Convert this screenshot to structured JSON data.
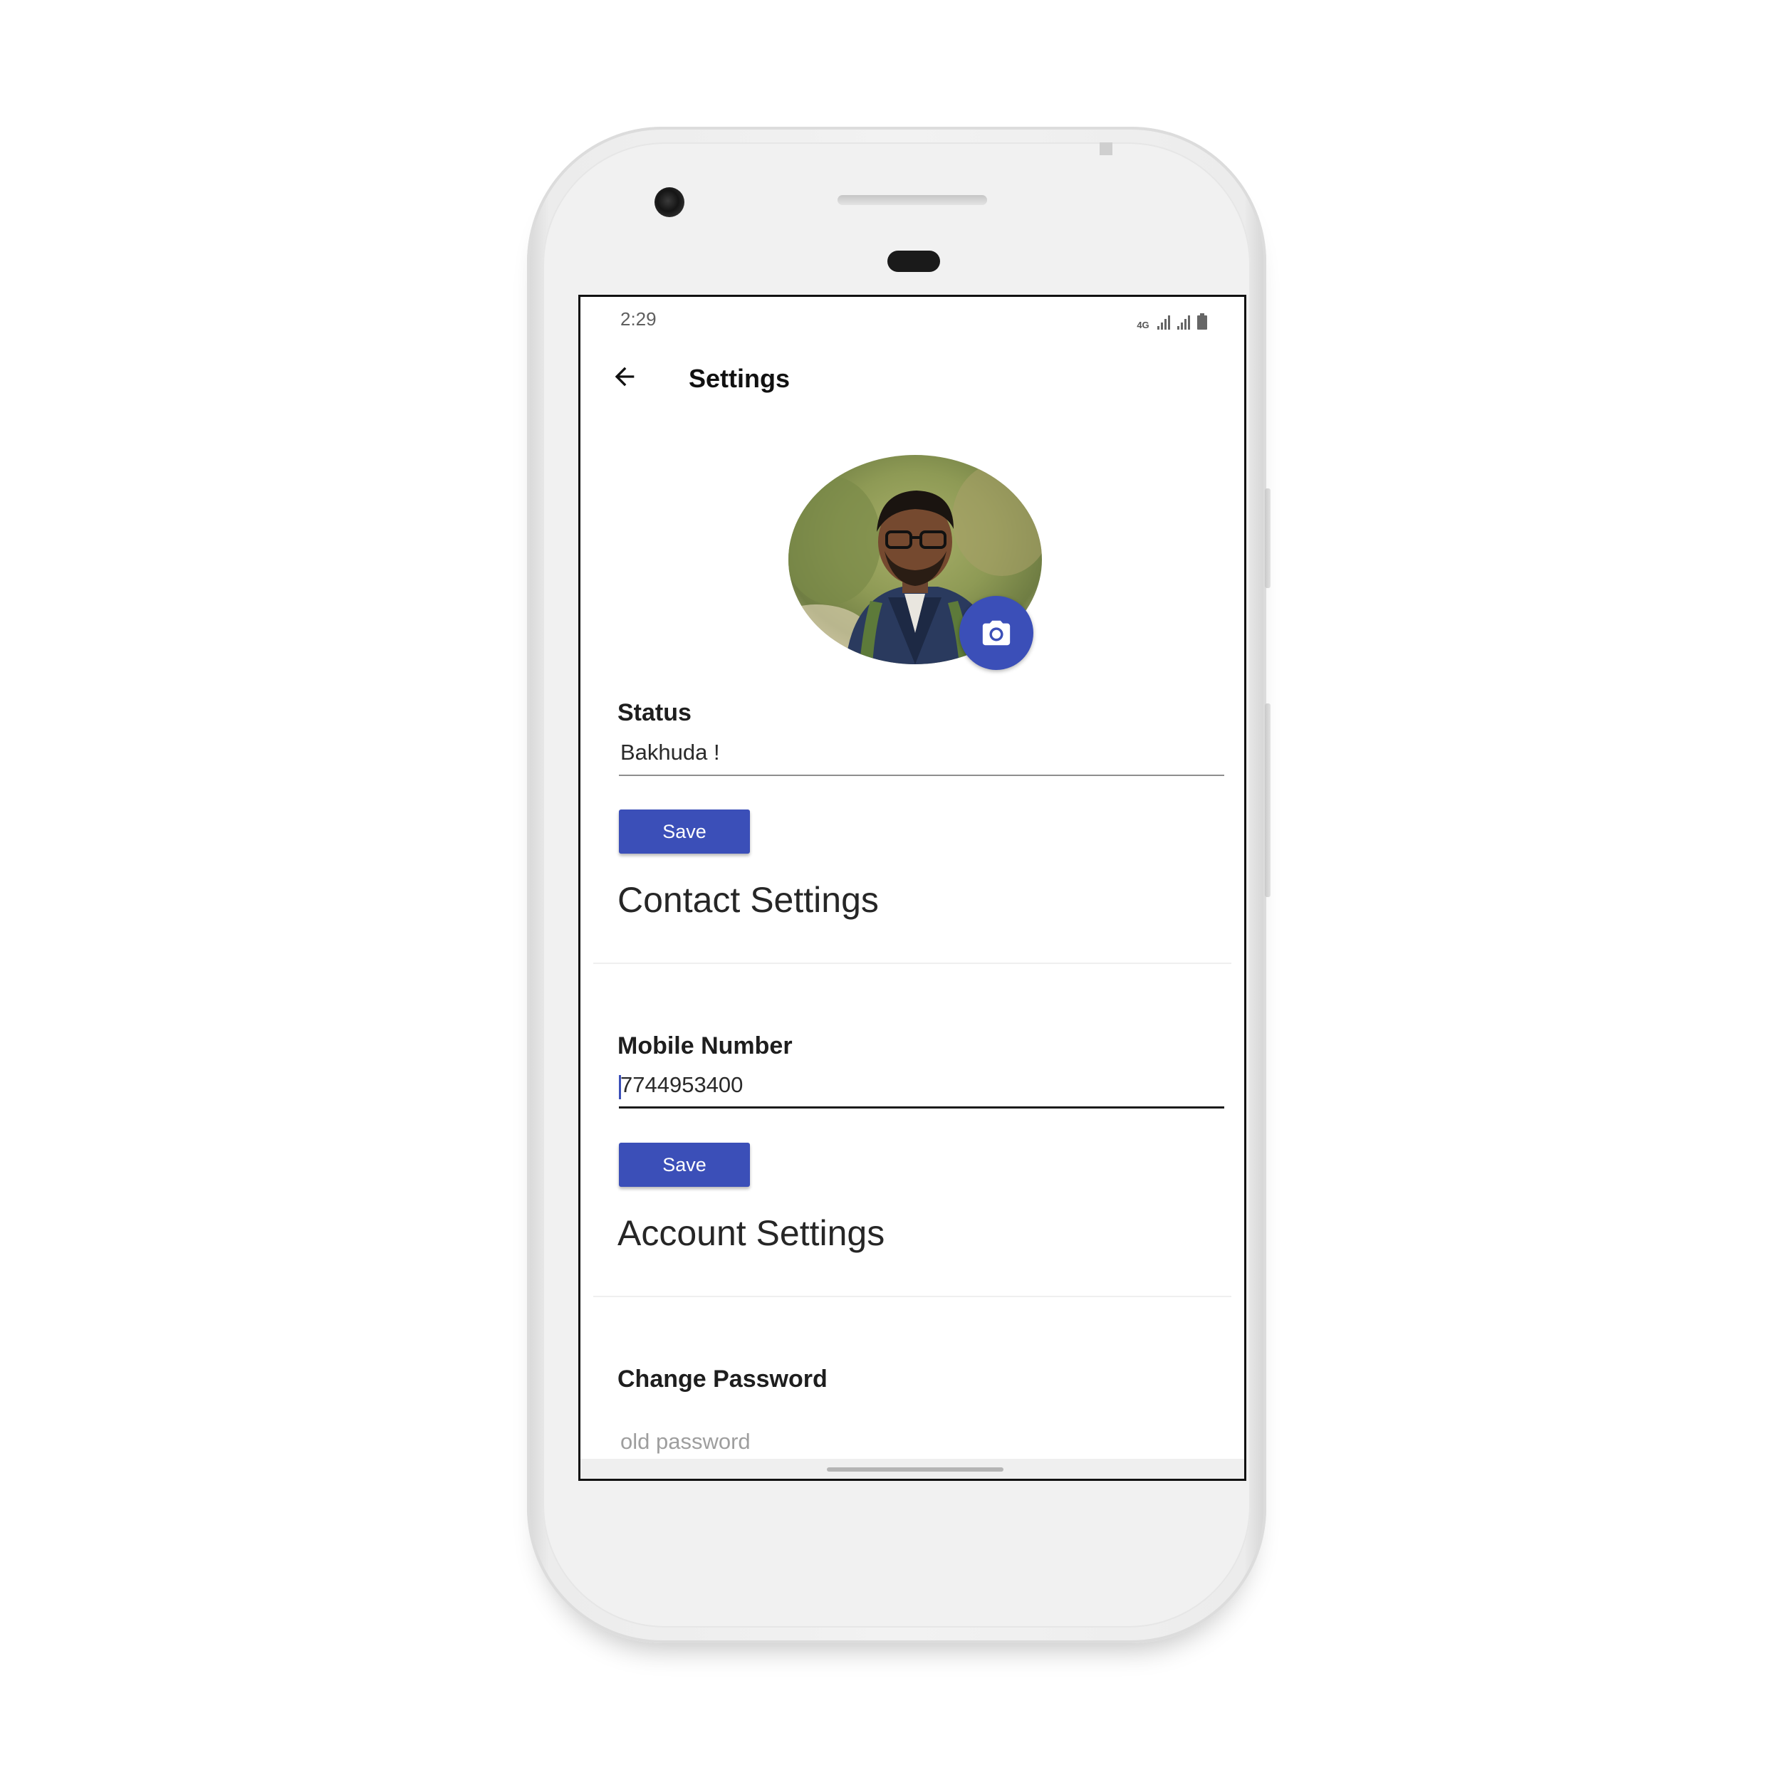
{
  "status_bar": {
    "time": "2:29",
    "network_label": "4G",
    "icons": [
      "network-4g-icon",
      "signal-icon",
      "signal-icon",
      "battery-icon"
    ]
  },
  "app_bar": {
    "title": "Settings",
    "back_icon": "arrow-left-icon"
  },
  "profile": {
    "avatar_alt": "profile photo",
    "change_photo_icon": "camera-icon"
  },
  "status_section": {
    "label": "Status",
    "value": "Bakhuda !",
    "save_label": "Save"
  },
  "contact_settings": {
    "heading": "Contact Settings",
    "mobile_label": "Mobile Number",
    "mobile_value": "7744953400",
    "save_label": "Save"
  },
  "account_settings": {
    "heading": "Account Settings",
    "change_password_label": "Change Password",
    "old_password_placeholder": "old password"
  },
  "colors": {
    "accent": "#3b4fb8",
    "background": "#ffffff",
    "text": "#1e1e1e"
  }
}
